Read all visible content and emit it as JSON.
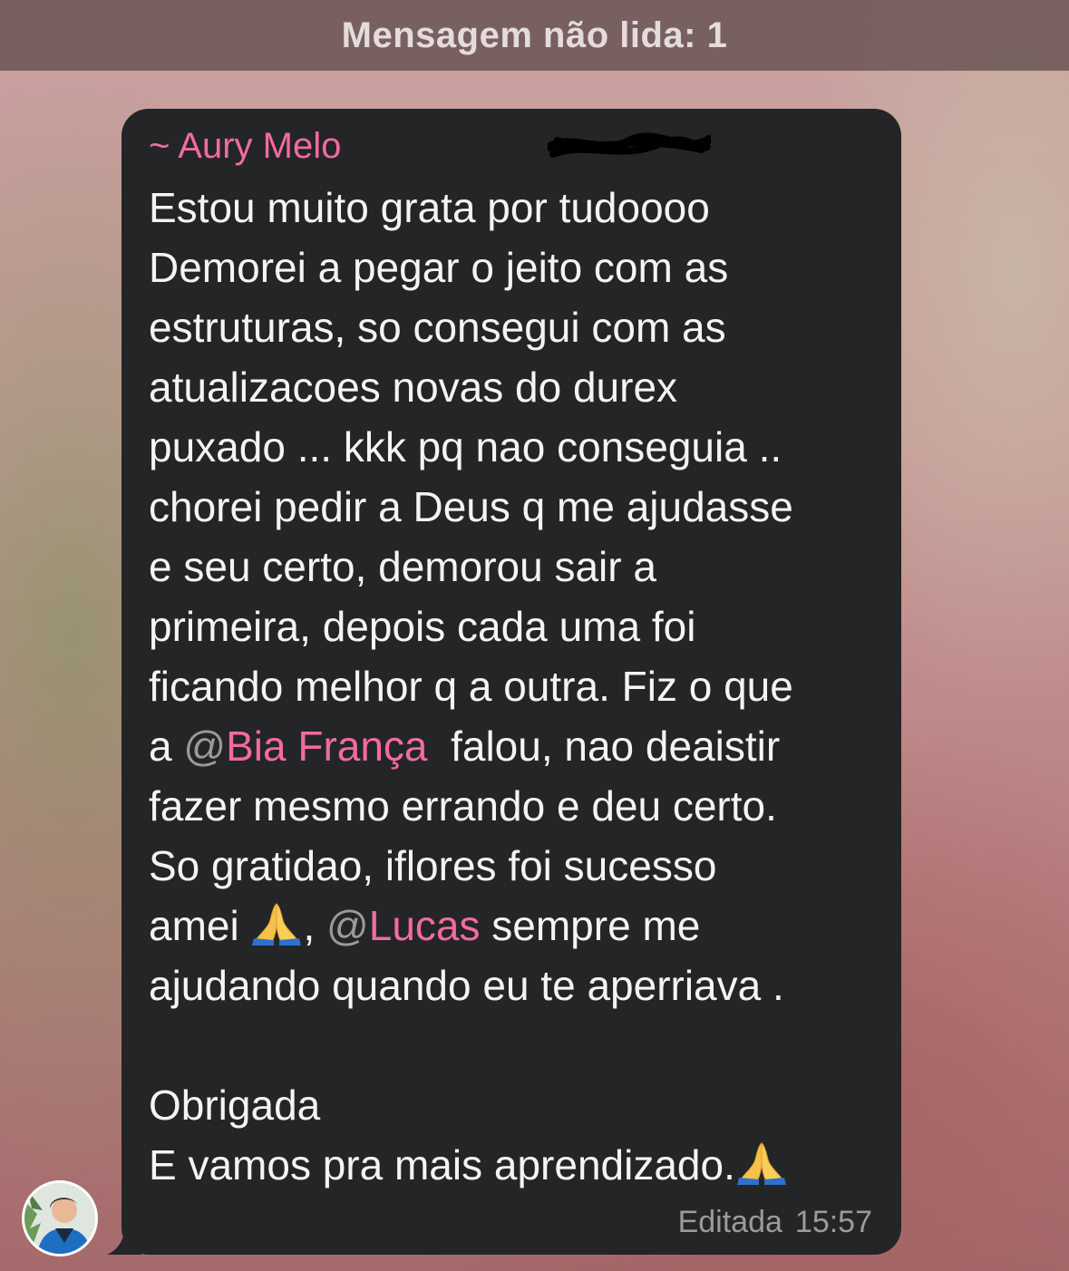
{
  "unread_banner": {
    "text": "Mensagem não lida: 1"
  },
  "message": {
    "sender": "~ Aury Melo",
    "lines": [
      "Estou muito grata por tudoooo",
      "Demorei a pegar o jeito com as",
      "estruturas, so consegui com as",
      "atualizacoes novas do durex",
      "puxado ... kkk pq nao conseguia ..",
      "chorei pedir a Deus q me ajudasse",
      "e seu certo, demorou sair a",
      "primeira, depois cada uma foi",
      "ficando melhor q a outra. Fiz o que"
    ],
    "mention_line": {
      "prefix": "a ",
      "at": "@",
      "name": "Bia França",
      "suffix": "  falou, nao deaistir"
    },
    "lines2": [
      "fazer mesmo errando e deu certo.",
      "So gratidao, iflores foi sucesso"
    ],
    "mention_line2": {
      "prefix": "amei ",
      "emoji": "praying-hands",
      "comma": ", ",
      "at": "@",
      "name": "Lucas",
      "suffix": " sempre me"
    },
    "lines3": [
      "ajudando quando eu te aperriava .",
      "",
      "Obrigada"
    ],
    "last_line": "E vamos pra mais aprendizado.",
    "edited_label": "Editada",
    "time": "15:57"
  },
  "colors": {
    "bubble": "#232526",
    "mention": "#f36b9c",
    "meta_text": "#9b9b9b"
  }
}
